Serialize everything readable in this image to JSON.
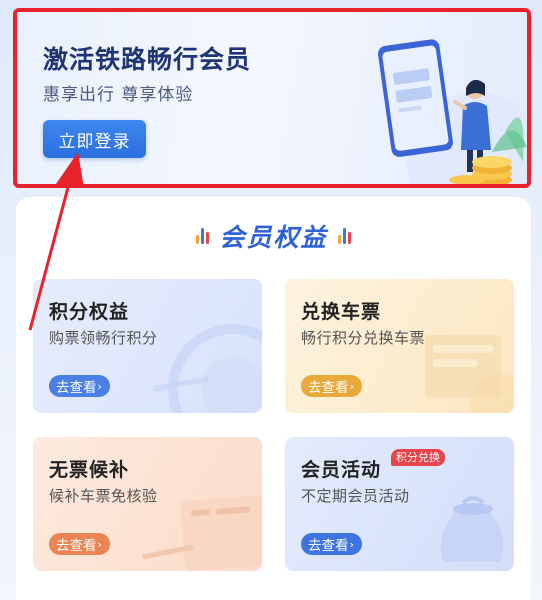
{
  "banner": {
    "title": "激活铁路畅行会员",
    "subtitle": "惠享出行 尊享体验",
    "login_label": "立即登录"
  },
  "benefits": {
    "title": "会员权益",
    "cards": [
      {
        "title": "积分权益",
        "desc": "购票领畅行积分",
        "action": "去查看",
        "accent": "#4a7fe6"
      },
      {
        "title": "兑换车票",
        "desc": "畅行积分兑换车票",
        "action": "去查看",
        "accent": "#e9a83a"
      },
      {
        "title": "无票候补",
        "desc": "候补车票免核验",
        "action": "去查看",
        "accent": "#ea8452"
      },
      {
        "title": "会员活动",
        "desc": "不定期会员活动",
        "action": "去查看",
        "accent": "#3e73e0",
        "badge": "积分兑换"
      }
    ]
  },
  "colors": {
    "highlight_border": "#e8232b",
    "primary": "#2b6fe0",
    "title_blue": "#2f62d6"
  }
}
